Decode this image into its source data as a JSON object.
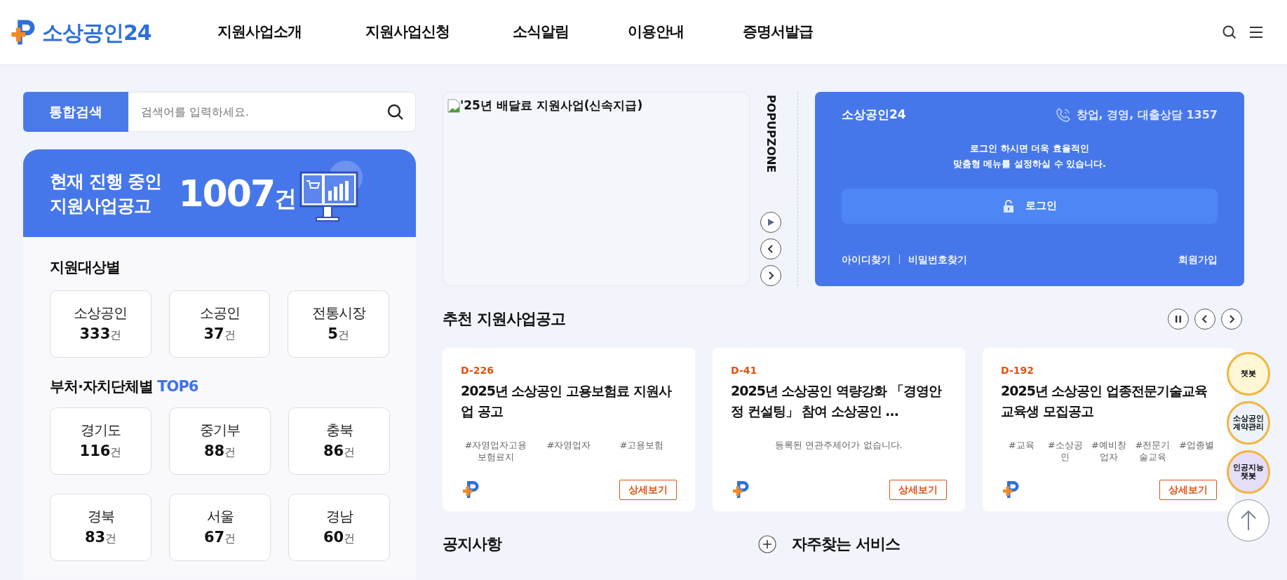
{
  "header": {
    "logo": "소상공인24",
    "nav": [
      "지원사업소개",
      "지원사업신청",
      "소식알림",
      "이용안내",
      "증명서발급"
    ]
  },
  "search": {
    "button": "통합검색",
    "placeholder": "검색어를 입력하세요."
  },
  "summary": {
    "line1": "현재 진행 중인",
    "line2": "지원사업공고",
    "count": "1007",
    "unit": "건"
  },
  "by_target": {
    "title": "지원대상별",
    "items": [
      {
        "label": "소상공인",
        "count": "333",
        "unit": "건"
      },
      {
        "label": "소공인",
        "count": "37",
        "unit": "건"
      },
      {
        "label": "전통시장",
        "count": "5",
        "unit": "건"
      }
    ]
  },
  "by_region": {
    "title": "부처·자치단체별",
    "highlight": "TOP6",
    "items": [
      {
        "label": "경기도",
        "count": "116",
        "unit": "건"
      },
      {
        "label": "중기부",
        "count": "88",
        "unit": "건"
      },
      {
        "label": "충북",
        "count": "86",
        "unit": "건"
      },
      {
        "label": "경북",
        "count": "83",
        "unit": "건"
      },
      {
        "label": "서울",
        "count": "67",
        "unit": "건"
      },
      {
        "label": "경남",
        "count": "60",
        "unit": "건"
      }
    ]
  },
  "popup": {
    "alt_text": "'25년 배달료 지원사업(신속지급)",
    "zone_label": "POPUPZONE",
    "playing": false
  },
  "login": {
    "brand": "소상공인24",
    "phone": "창업, 경영, 대출상담 1357",
    "message_lines": [
      "로그인 하시면 더욱 효율적인",
      "맞춤형 메뉴를 설정하실 수 있습니다."
    ],
    "button": "로그인",
    "links": [
      "아이디찾기",
      "비밀번호찾기"
    ],
    "signup": "회원가입"
  },
  "recommended": {
    "title": "추천 지원사업공고",
    "playing": true,
    "cards": [
      {
        "dday": "D-226",
        "title": "2025년 소상공인 고용보험료 지원사업 공고",
        "tags": [
          "#자영업자고용보험료지",
          "#자영업자",
          "#고용보험"
        ],
        "button": "상세보기"
      },
      {
        "dday": "D-41",
        "title": "2025년 소상공인 역량강화 「경영안정 컨설팅」 참여 소상공인 …",
        "empty_note": "등록된 연관주제어가 없습니다.",
        "button": "상세보기"
      },
      {
        "dday": "D-192",
        "title": "2025년 소상공인 업종전문기술교육 교육생 모집공고",
        "tags": [
          "#교육",
          "#소상공인",
          "#예비창업자",
          "#전문기술교육",
          "#업종별"
        ],
        "button": "상세보기"
      }
    ]
  },
  "notices": {
    "title": "공지사항"
  },
  "services": {
    "title": "자주찾는 서비스"
  },
  "floating": [
    {
      "kind": "mascot",
      "label": "챗봇"
    },
    {
      "kind": "docs",
      "label": "소상공인 계약관리"
    },
    {
      "kind": "robot",
      "label": "인공지능 챗봇"
    }
  ]
}
